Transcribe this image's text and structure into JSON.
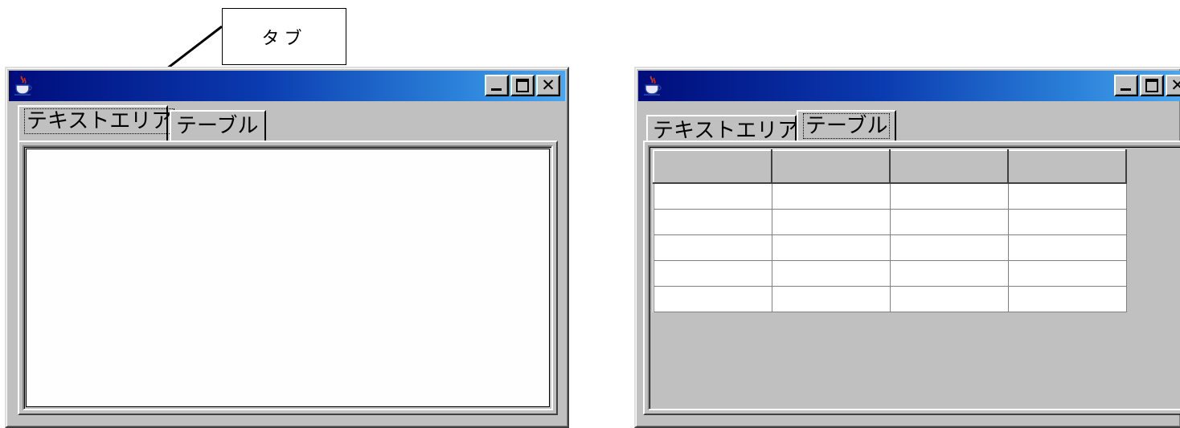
{
  "callout": {
    "label": "タブ"
  },
  "left_window": {
    "controls": {
      "minimize": "minimize",
      "maximize": "maximize",
      "close": "✕"
    },
    "tabs": [
      {
        "label": "テキストエリア",
        "selected": true
      },
      {
        "label": "テーブル",
        "selected": false
      }
    ],
    "textarea": {
      "value": ""
    }
  },
  "right_window": {
    "controls": {
      "minimize": "minimize",
      "maximize": "maximize",
      "close": "✕"
    },
    "tabs": [
      {
        "label": "テキストエリア",
        "selected": false
      },
      {
        "label": "テーブル",
        "selected": true
      }
    ],
    "table": {
      "columns": [
        "",
        "",
        "",
        ""
      ],
      "rows": [
        [
          "",
          "",
          "",
          ""
        ],
        [
          "",
          "",
          "",
          ""
        ],
        [
          "",
          "",
          "",
          ""
        ],
        [
          "",
          "",
          "",
          ""
        ],
        [
          "",
          "",
          "",
          ""
        ]
      ]
    }
  },
  "colors": {
    "window_face": "#c0c0c0",
    "titlebar_start": "#000c7b",
    "titlebar_end": "#4aa6ef"
  },
  "icons": [
    "java-coffee-icon",
    "minimize-icon",
    "maximize-icon",
    "close-icon"
  ]
}
